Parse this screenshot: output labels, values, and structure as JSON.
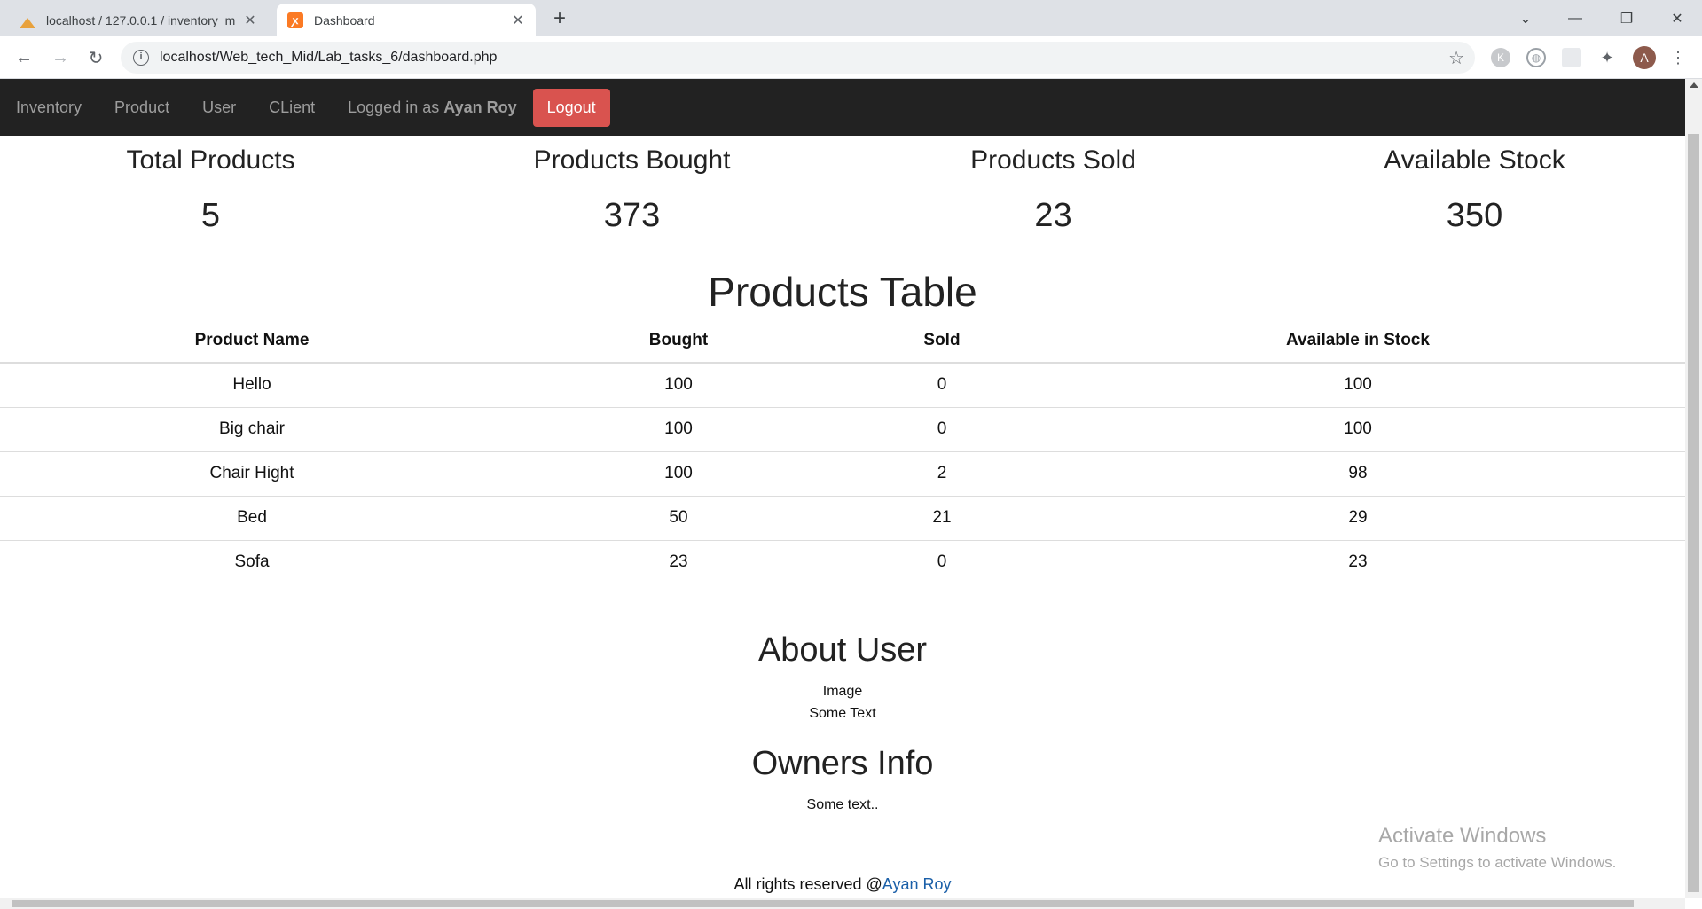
{
  "browser": {
    "tabs": [
      {
        "title": "localhost / 127.0.0.1 / inventory_m",
        "favicon": "phpmyadmin-icon"
      },
      {
        "title": "Dashboard",
        "favicon": "xampp-icon"
      }
    ],
    "url": "localhost/Web_tech_Mid/Lab_tasks_6/dashboard.php",
    "profile_initial": "A",
    "extension_initial": "K"
  },
  "navbar": {
    "links": [
      "Inventory",
      "Product",
      "User",
      "CLient"
    ],
    "logged_in_prefix": "Logged in as",
    "user_name": "Ayan Roy",
    "logout_label": "Logout"
  },
  "stats": [
    {
      "label": "Total Products",
      "value": "5"
    },
    {
      "label": "Products Bought",
      "value": "373"
    },
    {
      "label": "Products Sold",
      "value": "23"
    },
    {
      "label": "Available Stock",
      "value": "350"
    }
  ],
  "products_table": {
    "title": "Products Table",
    "headers": [
      "Product Name",
      "Bought",
      "Sold",
      "Available in Stock"
    ],
    "rows": [
      [
        "Hello",
        "100",
        "0",
        "100"
      ],
      [
        "Big chair",
        "100",
        "0",
        "100"
      ],
      [
        "Chair Hight",
        "100",
        "2",
        "98"
      ],
      [
        "Bed",
        "50",
        "21",
        "29"
      ],
      [
        "Sofa",
        "23",
        "0",
        "23"
      ]
    ]
  },
  "about_user": {
    "title": "About User",
    "image_text": "Image",
    "text": "Some Text"
  },
  "owners_info": {
    "title": "Owners Info",
    "text": "Some text.."
  },
  "watermark": {
    "line1": "Activate Windows",
    "line2": "Go to Settings to activate Windows."
  },
  "footer": {
    "text": "All rights reserved @",
    "link_text": "Ayan Roy"
  },
  "colors": {
    "navbar_bg": "#222222",
    "logout_bg": "#d9534f",
    "link": "#1a5fa8"
  }
}
